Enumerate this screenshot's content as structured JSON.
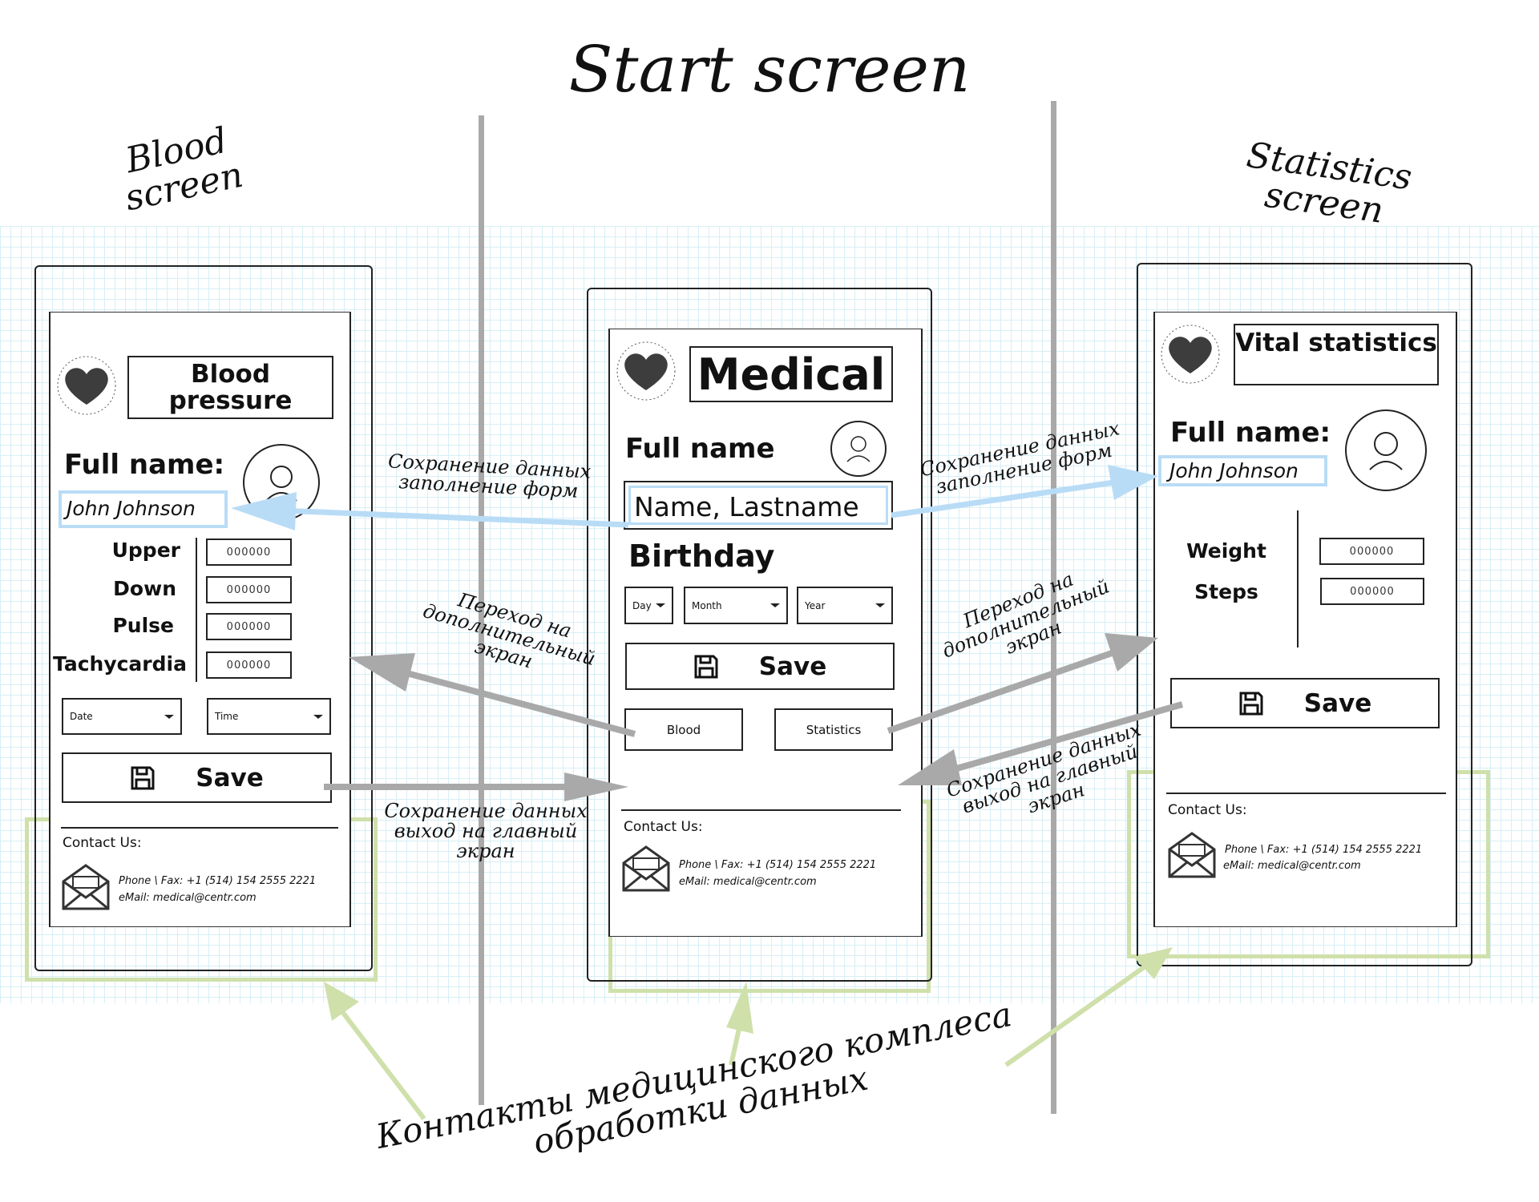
{
  "title": "Start screen",
  "screen_labels": {
    "blood": "Blood screen",
    "statistics": "Statistics screen"
  },
  "annotations": {
    "save_fill": "Сохранение данных\nзаполнение форм",
    "goto_extra": "Переход на\nдополнительный\nэкран",
    "save_exit": "Сохранение данных\nвыход на главный\nэкран",
    "contacts": "Контакты медицинского комплеса\nобработки данных"
  },
  "contact": {
    "heading": "Contact Us:",
    "phone": "Phone \\ Fax: +1 (514) 154 2555 2221",
    "email": "eMail: medical@centr.com"
  },
  "blood_screen": {
    "title": "Blood pressure",
    "full_name_label": "Full name:",
    "full_name_value": "John Johnson",
    "fields": [
      {
        "label": "Upper",
        "value": "000000"
      },
      {
        "label": "Down",
        "value": "000000"
      },
      {
        "label": "Pulse",
        "value": "000000"
      },
      {
        "label": "Tachycardia",
        "value": "000000"
      }
    ],
    "date": "Date",
    "time": "Time",
    "save": "Save"
  },
  "main_screen": {
    "title": "Medical",
    "full_name_label": "Full name",
    "name_placeholder": "Name, Lastname",
    "birthday_label": "Birthday",
    "day": "Day",
    "month": "Month",
    "year": "Year",
    "save": "Save",
    "blood_button": "Blood",
    "statistics_button": "Statistics"
  },
  "statistics_screen": {
    "title": "Vital statistics",
    "full_name_label": "Full name:",
    "full_name_value": "John Johnson",
    "fields": [
      {
        "label": "Weight",
        "value": "000000"
      },
      {
        "label": "Steps",
        "value": "000000"
      }
    ],
    "save": "Save"
  },
  "colors": {
    "blue_arrow": "#b9dcf6",
    "gray_arrow": "#a9a9a9",
    "green_highlight": "#cfe0ab",
    "heart": "#3d3d3d"
  }
}
